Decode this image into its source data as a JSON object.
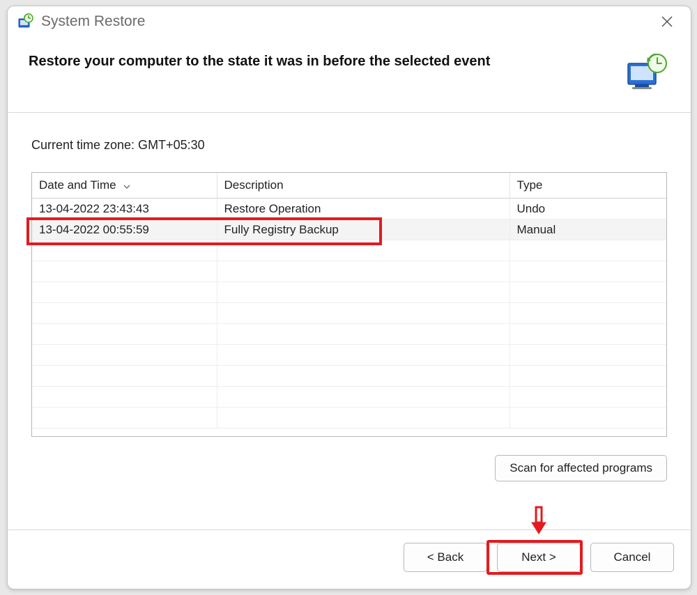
{
  "window": {
    "title": "System Restore"
  },
  "header": {
    "heading": "Restore your computer to the state it was in before the selected event"
  },
  "timezone_label": "Current time zone: GMT+05:30",
  "table": {
    "columns": {
      "date": "Date and Time",
      "desc": "Description",
      "type": "Type"
    },
    "rows": [
      {
        "date": "13-04-2022 23:43:43",
        "desc": "Restore Operation",
        "type": "Undo"
      },
      {
        "date": "13-04-2022 00:55:59",
        "desc": "Fully Registry Backup",
        "type": "Manual"
      }
    ]
  },
  "buttons": {
    "scan": "Scan for affected programs",
    "back": "< Back",
    "next": "Next >",
    "cancel": "Cancel"
  }
}
